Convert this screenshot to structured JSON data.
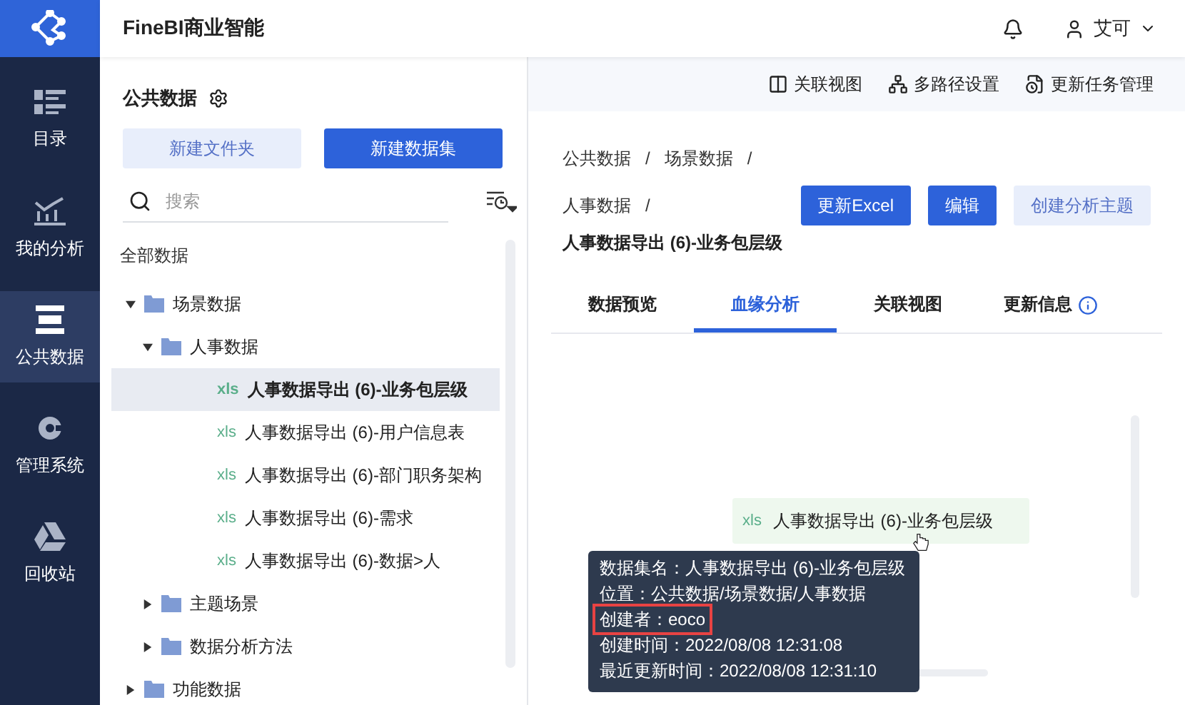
{
  "app": {
    "title": "FineBI商业智能",
    "user": "艾可"
  },
  "nav": [
    {
      "label": "目录",
      "selected": false
    },
    {
      "label": "我的分析",
      "selected": false
    },
    {
      "label": "公共数据",
      "selected": true
    },
    {
      "label": "管理系统",
      "selected": false
    },
    {
      "label": "回收站",
      "selected": false
    }
  ],
  "panel": {
    "title": "公共数据",
    "buttons": [
      {
        "label": "新建文件夹",
        "kind": "secondary"
      },
      {
        "label": "新建数据集",
        "kind": "primary"
      }
    ],
    "search": {
      "placeholder": "搜索"
    },
    "root": "全部数据",
    "tree": [
      {
        "label": "场景数据",
        "kind": "folder",
        "expanded": true,
        "children": [
          {
            "label": "人事数据",
            "kind": "folder",
            "expanded": true,
            "children": [
              {
                "label": "人事数据导出 (6)-业务包层级",
                "kind": "file",
                "tag": "xls",
                "selected": true
              },
              {
                "label": "人事数据导出 (6)-用户信息表",
                "kind": "file",
                "tag": "xls",
                "selected": false
              },
              {
                "label": "人事数据导出 (6)-部门职务架构",
                "kind": "file",
                "tag": "xls",
                "selected": false
              },
              {
                "label": "人事数据导出 (6)-需求",
                "kind": "file",
                "tag": "xls",
                "selected": false
              },
              {
                "label": "人事数据导出 (6)-数据>人",
                "kind": "file",
                "tag": "xls",
                "selected": false
              }
            ]
          },
          {
            "label": "主题场景",
            "kind": "folder",
            "expanded": false
          },
          {
            "label": "数据分析方法",
            "kind": "folder",
            "expanded": false
          }
        ]
      },
      {
        "label": "功能数据",
        "kind": "folder",
        "expanded": false
      }
    ]
  },
  "toolbar": [
    {
      "label": "关联视图"
    },
    {
      "label": "多路径设置"
    },
    {
      "label": "更新任务管理"
    }
  ],
  "detail": {
    "breadcrumb": [
      "公共数据",
      "场景数据",
      "人事数据"
    ],
    "separator": "/",
    "title": "人事数据导出 (6)-业务包层级",
    "actions": [
      {
        "label": "更新Excel",
        "kind": "primary"
      },
      {
        "label": "编辑",
        "kind": "primary"
      },
      {
        "label": "创建分析主题",
        "kind": "secondary"
      }
    ],
    "tabs": [
      {
        "label": "数据预览",
        "selected": false,
        "info": false
      },
      {
        "label": "血缘分析",
        "selected": true,
        "info": false
      },
      {
        "label": "关联视图",
        "selected": false,
        "info": false
      },
      {
        "label": "更新信息",
        "selected": false,
        "info": true
      }
    ],
    "node": {
      "tag": "xls",
      "label": "人事数据导出 (6)-业务包层级"
    },
    "tooltip": [
      {
        "text": "数据集名：人事数据导出 (6)-业务包层级",
        "highlighted": false
      },
      {
        "text": "位置：公共数据/场景数据/人事数据",
        "highlighted": false
      },
      {
        "text": "创建者：eoco",
        "highlighted": true
      },
      {
        "text": "创建时间：2022/08/08 12:31:08",
        "highlighted": false
      },
      {
        "text": "最近更新时间：2022/08/08 12:31:10",
        "highlighted": false
      }
    ]
  }
}
